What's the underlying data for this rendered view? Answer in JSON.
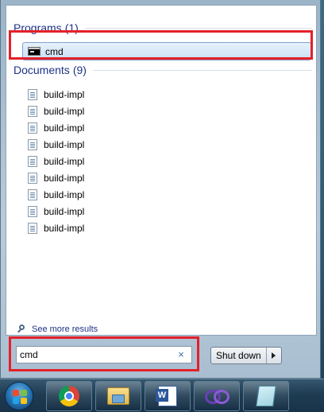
{
  "search_results": {
    "programs_group": {
      "label": "Programs",
      "count": "(1)",
      "items": [
        {
          "label": "cmd",
          "icon": "command-prompt-icon"
        }
      ]
    },
    "documents_group": {
      "label": "Documents",
      "count": "(9)",
      "items": [
        {
          "label": "build-impl",
          "icon": "document-icon"
        },
        {
          "label": "build-impl",
          "icon": "document-icon"
        },
        {
          "label": "build-impl",
          "icon": "document-icon"
        },
        {
          "label": "build-impl",
          "icon": "document-icon"
        },
        {
          "label": "build-impl",
          "icon": "document-icon"
        },
        {
          "label": "build-impl",
          "icon": "document-icon"
        },
        {
          "label": "build-impl",
          "icon": "document-icon"
        },
        {
          "label": "build-impl",
          "icon": "document-icon"
        },
        {
          "label": "build-impl",
          "icon": "document-icon"
        }
      ]
    },
    "see_more_label": "See more results"
  },
  "search": {
    "value": "cmd",
    "clear_icon": "×"
  },
  "shutdown": {
    "label": "Shut down"
  },
  "taskbar": {
    "items": [
      {
        "name": "start-orb",
        "icon": "windows-start-icon"
      },
      {
        "name": "chrome",
        "icon": "chrome-icon"
      },
      {
        "name": "windows-explorer",
        "icon": "folder-icon"
      },
      {
        "name": "word",
        "icon": "word-icon"
      },
      {
        "name": "visual-studio",
        "icon": "visual-studio-icon"
      },
      {
        "name": "notepad",
        "icon": "notepad-icon"
      }
    ]
  },
  "colors": {
    "group_header": "#1e3287",
    "highlight_outline": "#e4202a",
    "selected_row": "#c9e0f5"
  }
}
